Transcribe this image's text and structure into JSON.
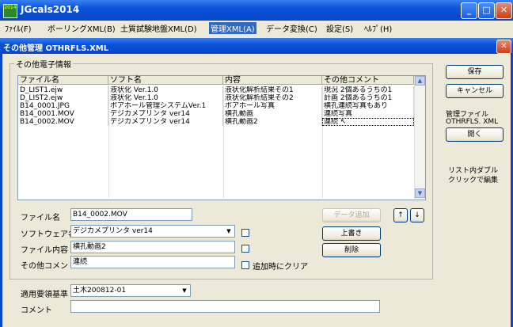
{
  "app": {
    "title": "JGcals2014",
    "icon_label": "2014",
    "icon": "app-logo-icon"
  },
  "window_buttons": {
    "minimize": "_",
    "maximize": "□",
    "close": "✕"
  },
  "menu": [
    {
      "label": "ﾌｧｲﾙ(F)"
    },
    {
      "label": "ボーリングXML(B)"
    },
    {
      "label": "土質試験地盤XML(D)"
    },
    {
      "label": "管理XML(A)"
    },
    {
      "label": "データ変換(C)"
    },
    {
      "label": "設定(S)"
    },
    {
      "label": "ﾍﾙﾌﾟ(H)"
    }
  ],
  "child_window": {
    "title": "その他管理 OTHRFLS.XML",
    "close": "✕"
  },
  "group_title": "その他電子情報",
  "list": {
    "columns": [
      "ファイル名",
      "ソフト名",
      "内容",
      "その他コメント"
    ],
    "rows": [
      [
        "D_LIST1.ejw",
        "液状化 Ver.1.0",
        "液状化解析結果その1",
        "現況 2個あるうちの1"
      ],
      [
        "D_LIST2.ejw",
        "液状化 Ver.1.0",
        "液状化解析結果その2",
        "計画 2個あるうちの1"
      ],
      [
        "B14_0001.JPG",
        "ボアホール管理システムVer.1",
        "ボアホール写真",
        "横孔連続写真もあり"
      ],
      [
        "B14_0001.MOV",
        "デジカメプリンタ ver14",
        "横孔動画",
        "連続写真"
      ],
      [
        "B14_0002.MOV",
        "デジカメプリンタ ver14",
        "横孔動画2",
        "連続 ↖"
      ]
    ],
    "scroll_up": "▲",
    "scroll_down": "▼"
  },
  "form": {
    "filename_label": "ファイル名",
    "filename_value": "B14_0002.MOV",
    "software_label": "ソフトウェア名",
    "software_value": "デジカメプリンタ ver14",
    "content_label": "ファイル内容",
    "content_value": "横孔動画2",
    "comment_label": "その他コメント",
    "comment_value": "連続",
    "clear_on_add_label": "追加時にクリア",
    "combo_arrow": "▼"
  },
  "buttons": {
    "add_data": "データ追加",
    "move_up": "↑",
    "move_down": "↓",
    "overwrite": "上書き",
    "delete": "削除",
    "save": "保存",
    "cancel": "キャンセル",
    "open": "開く"
  },
  "side": {
    "mgmt_file_label": "管理ファイル",
    "mgmt_file_name": "OTHRFLS. XML",
    "hint_line1": "リスト内ダブル",
    "hint_line2": "クリックで編集"
  },
  "bottom": {
    "standard_label": "適用要領基準",
    "standard_value": "土木200812-01",
    "comment_label": "コメント",
    "comment_value": ""
  }
}
